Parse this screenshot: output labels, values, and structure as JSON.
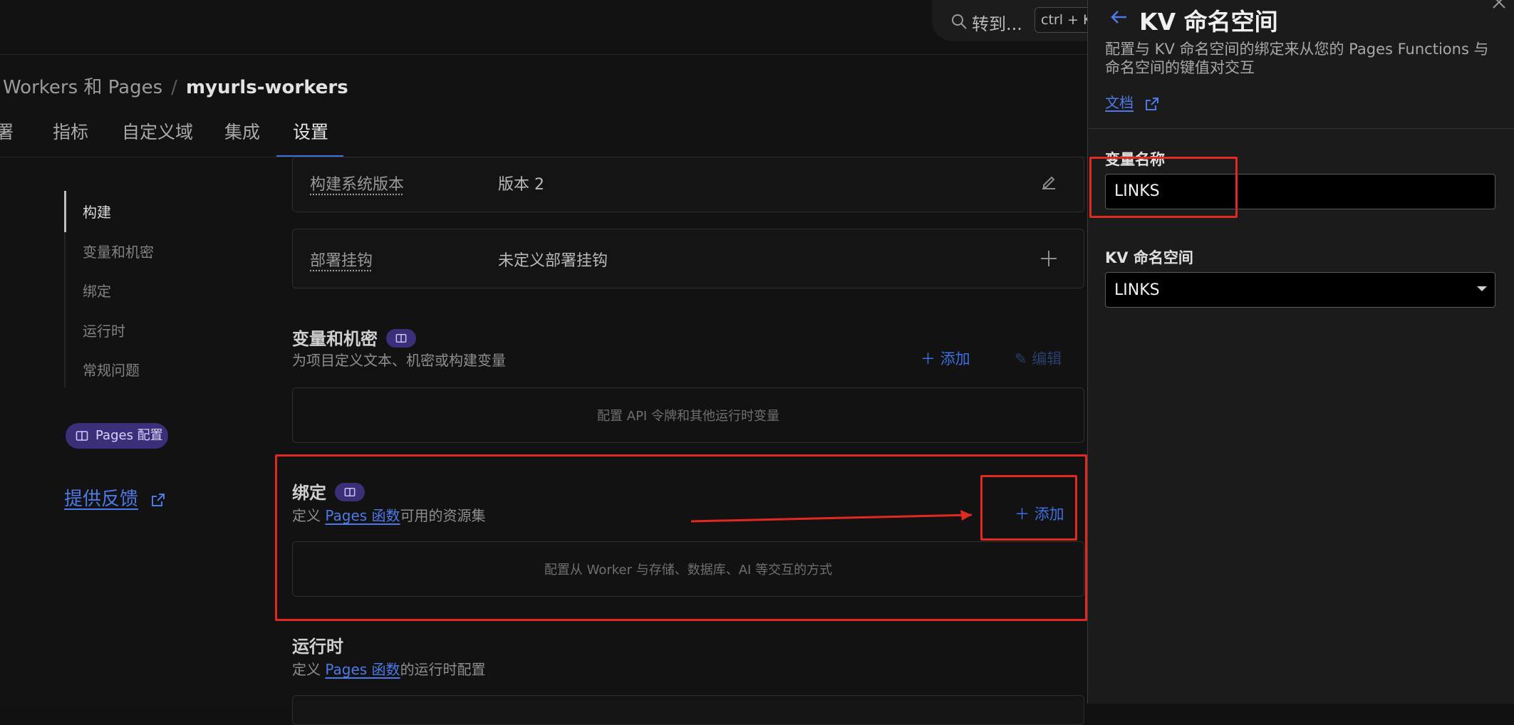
{
  "search": {
    "placeholder": "转到...",
    "shortcut": "ctrl + K"
  },
  "breadcrumb": {
    "parent": "Workers 和 Pages",
    "separator": "/",
    "current": "myurls-workers"
  },
  "tabs": [
    {
      "label": "署"
    },
    {
      "label": "指标"
    },
    {
      "label": "自定义域"
    },
    {
      "label": "集成"
    },
    {
      "label": "设置"
    }
  ],
  "sidenav": {
    "items": [
      {
        "label": "构建"
      },
      {
        "label": "变量和机密"
      },
      {
        "label": "绑定"
      },
      {
        "label": "运行时"
      },
      {
        "label": "常规问题"
      }
    ],
    "pages_config_label": "Pages 配置",
    "feedback_label": "提供反馈"
  },
  "build_version": {
    "label": "构建系统版本",
    "value": "版本 2"
  },
  "deploy_hooks": {
    "label": "部署挂钩",
    "value": "未定义部署挂钩"
  },
  "variables": {
    "title": "变量和机密",
    "description": "为项目定义文本、机密或构建变量",
    "add_label": "添加",
    "edit_label": "编辑",
    "empty_text": "配置 API 令牌和其他运行时变量"
  },
  "bindings": {
    "title": "绑定",
    "desc_prefix": "定义 ",
    "desc_link": "Pages 函数",
    "desc_suffix": "可用的资源集",
    "add_label": "添加",
    "empty_text": "配置从 Worker 与存储、数据库、AI 等交互的方式"
  },
  "runtime": {
    "title": "运行时",
    "desc_prefix": "定义 ",
    "desc_link": "Pages 函数",
    "desc_suffix": "的运行时配置"
  },
  "panel": {
    "title": "KV 命名空间",
    "description": "配置与 KV 命名空间的绑定来从您的 Pages Functions 与命名空间的键值对交互",
    "docs_label": "文档",
    "var_name_label": "变量名称",
    "var_name_value": "LINKS",
    "kv_namespace_label": "KV 命名空间",
    "kv_namespace_value": "LINKS"
  },
  "colors": {
    "accent": "#3f6fe0",
    "link": "#4e79e8",
    "highlight_red": "#e02a21",
    "badge": "#3b2f7a"
  }
}
